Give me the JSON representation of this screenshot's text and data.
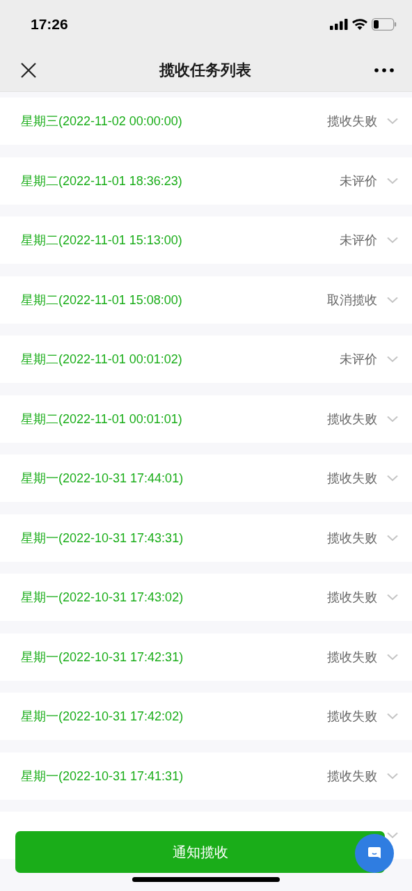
{
  "status_bar": {
    "time": "17:26"
  },
  "nav": {
    "title": "揽收任务列表"
  },
  "tasks": [
    {
      "date": "星期三(2022-11-02 00:00:00)",
      "status": "揽收失败"
    },
    {
      "date": "星期二(2022-11-01 18:36:23)",
      "status": "未评价"
    },
    {
      "date": "星期二(2022-11-01 15:13:00)",
      "status": "未评价"
    },
    {
      "date": "星期二(2022-11-01 15:08:00)",
      "status": "取消揽收"
    },
    {
      "date": "星期二(2022-11-01 00:01:02)",
      "status": "未评价"
    },
    {
      "date": "星期二(2022-11-01 00:01:01)",
      "status": "揽收失败"
    },
    {
      "date": "星期一(2022-10-31 17:44:01)",
      "status": "揽收失败"
    },
    {
      "date": "星期一(2022-10-31 17:43:31)",
      "status": "揽收失败"
    },
    {
      "date": "星期一(2022-10-31 17:43:02)",
      "status": "揽收失败"
    },
    {
      "date": "星期一(2022-10-31 17:42:31)",
      "status": "揽收失败"
    },
    {
      "date": "星期一(2022-10-31 17:42:02)",
      "status": "揽收失败"
    },
    {
      "date": "星期一(2022-10-31 17:41:31)",
      "status": "揽收失败"
    }
  ],
  "primary_button": "通知揽收"
}
